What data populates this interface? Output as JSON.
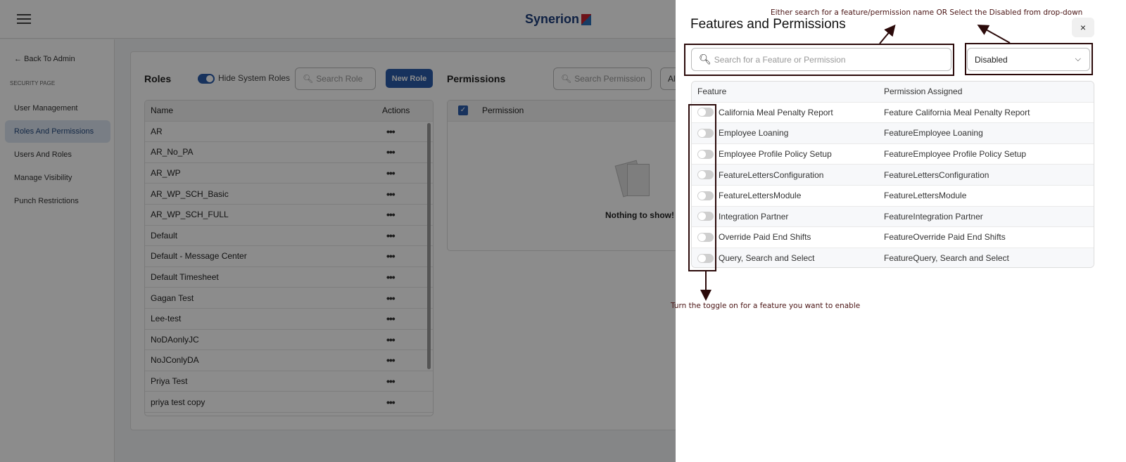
{
  "header": {
    "logo": "Synerion",
    "menu_icon": "hamburger-icon"
  },
  "sidebar": {
    "back": "Back To Admin",
    "section": "SECURITY PAGE",
    "items": [
      {
        "label": "User Management",
        "active": false
      },
      {
        "label": "Roles And Permissions",
        "active": true
      },
      {
        "label": "Users And Roles",
        "active": false
      },
      {
        "label": "Manage Visibility",
        "active": false
      },
      {
        "label": "Punch Restrictions",
        "active": false
      }
    ]
  },
  "roles": {
    "title": "Roles",
    "hide_system_label": "Hide System Roles",
    "hide_system_on": true,
    "search_placeholder": "Search Role",
    "new_button": "New Role",
    "columns": [
      "Name",
      "Actions"
    ],
    "rows": [
      "AR",
      "AR_No_PA",
      "AR_WP",
      "AR_WP_SCH_Basic",
      "AR_WP_SCH_FULL",
      "Default",
      "Default - Message Center",
      "Default Timesheet",
      "Gagan Test",
      "Lee-test",
      "NoDAonlyJC",
      "NoJConlyDA",
      "Priya Test",
      "priya test copy"
    ],
    "actions_glyph": "•••"
  },
  "permissions": {
    "title": "Permissions",
    "search_placeholder": "Search Permission",
    "filter_partial": "All",
    "column": "Permission",
    "empty": "Nothing to show!"
  },
  "drawer": {
    "title": "Features and Permissions",
    "close": "×",
    "search_placeholder": "Search for a Feature or Permission",
    "filter_value": "Disabled",
    "columns": [
      "Feature",
      "Permission Assigned"
    ],
    "rows": [
      {
        "feature": "California Meal Penalty Report",
        "permission": "Feature California Meal Penalty Report",
        "enabled": false
      },
      {
        "feature": "Employee Loaning",
        "permission": "FeatureEmployee Loaning",
        "enabled": false
      },
      {
        "feature": "Employee Profile Policy Setup",
        "permission": "FeatureEmployee Profile Policy Setup",
        "enabled": false
      },
      {
        "feature": "FeatureLettersConfiguration",
        "permission": "FeatureLettersConfiguration",
        "enabled": false
      },
      {
        "feature": "FeatureLettersModule",
        "permission": "FeatureLettersModule",
        "enabled": false
      },
      {
        "feature": "Integration Partner",
        "permission": "FeatureIntegration Partner",
        "enabled": false
      },
      {
        "feature": "Override Paid End Shifts",
        "permission": "FeatureOverride Paid End Shifts",
        "enabled": false
      },
      {
        "feature": "Query, Search and Select",
        "permission": "FeatureQuery, Search and Select",
        "enabled": false
      }
    ]
  },
  "annotations": {
    "top": "Either search for a feature/permission name OR Select the Disabled from drop-down",
    "bottom": "Turn the toggle on for a feature you want to enable",
    "color": "#2b0a0a"
  }
}
